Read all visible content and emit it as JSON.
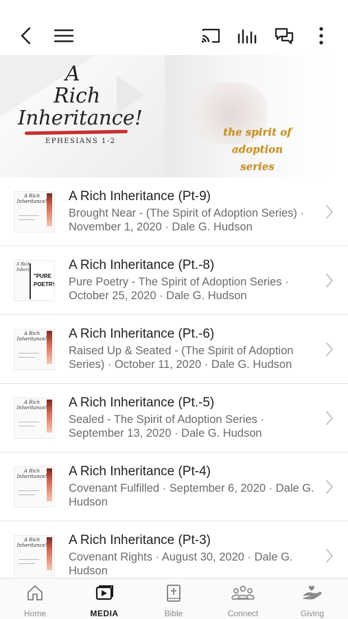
{
  "toolbar": {
    "icons": [
      "back-icon",
      "menu-icon",
      "cast-icon",
      "audio-icon",
      "chat-icon",
      "more-icon"
    ]
  },
  "banner": {
    "title_line1": "A",
    "title_line2": "Rich",
    "title_line3": "Inheritance!",
    "scripture": "EPHESIANS 1-2",
    "series_line1": "the spirit of adoption",
    "series_line2": "series",
    "series_color": "#c9921e",
    "underline_color": "#c6312e"
  },
  "thumbnail_text": {
    "title": "A Rich Inheritance!",
    "pure": "\"PURE",
    "poetry": "POETRY"
  },
  "media_items": [
    {
      "title": "A Rich Inheritance (Pt-9)",
      "description": "Brought Near - (The Spirit of Adoption Series) · November 1, 2020 · Dale G. Hudson"
    },
    {
      "title": "A Rich Inheritance (Pt.-8)",
      "description": "Pure Poetry - The Spirit of Adoption Series · October 25, 2020 · Dale G. Hudson"
    },
    {
      "title": "A Rich Inheritance (Pt.-6)",
      "description": "Raised Up & Seated - (The Spirit of Adoption Series) · October 11, 2020 · Dale G. Hudson"
    },
    {
      "title": "A Rich Inheritance (Pt.-5)",
      "description": "Sealed - The Spirit of Adoption Series · September 13, 2020 · Dale G. Hudson"
    },
    {
      "title": "A Rich Inheritance (Pt-4)",
      "description": "Covenant Fulfilled · September 6, 2020 · Dale G. Hudson"
    },
    {
      "title": "A Rich Inheritance (Pt-3)",
      "description": "Covenant Rights · August 30, 2020 · Dale G. Hudson"
    }
  ],
  "tabs": [
    {
      "label": "Home",
      "icon": "home-icon",
      "active": false
    },
    {
      "label": "MEDIA",
      "icon": "media-icon",
      "active": true
    },
    {
      "label": "Bible",
      "icon": "bible-icon",
      "active": false
    },
    {
      "label": "Connect",
      "icon": "connect-icon",
      "active": false
    },
    {
      "label": "Giving",
      "icon": "giving-icon",
      "active": false
    }
  ],
  "colors": {
    "active_tab": "#1c1c1c",
    "inactive_tab": "#8a8a8a",
    "description_text": "#6b6b6b"
  }
}
